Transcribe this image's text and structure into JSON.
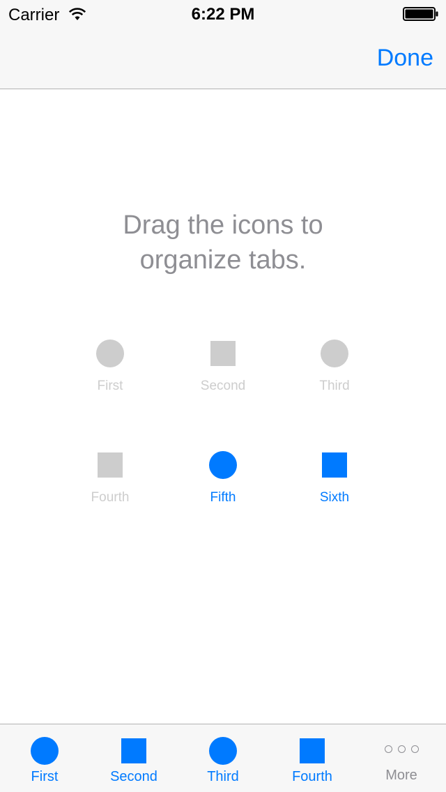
{
  "status_bar": {
    "carrier": "Carrier",
    "time": "6:22 PM",
    "wifi_icon": "wifi-icon",
    "battery_icon": "battery-icon"
  },
  "nav_bar": {
    "done_label": "Done"
  },
  "instruction": {
    "line1": "Drag the icons to",
    "line2": "organize tabs."
  },
  "customize_items": [
    {
      "label": "First",
      "shape": "circle",
      "state": "inactive"
    },
    {
      "label": "Second",
      "shape": "square",
      "state": "inactive"
    },
    {
      "label": "Third",
      "shape": "circle",
      "state": "inactive"
    },
    {
      "label": "Fourth",
      "shape": "square",
      "state": "inactive"
    },
    {
      "label": "Fifth",
      "shape": "circle",
      "state": "active"
    },
    {
      "label": "Sixth",
      "shape": "square",
      "state": "active"
    }
  ],
  "tab_bar": {
    "items": [
      {
        "label": "First",
        "icon": "circle-icon"
      },
      {
        "label": "Second",
        "icon": "square-icon"
      },
      {
        "label": "Third",
        "icon": "circle-icon"
      },
      {
        "label": "Fourth",
        "icon": "square-icon"
      },
      {
        "label": "More",
        "icon": "more-icon"
      }
    ]
  },
  "colors": {
    "accent": "#007aff",
    "inactive": "#cdcdcd",
    "secondary_text": "#8e8e93",
    "bar_background": "#f7f7f7"
  }
}
